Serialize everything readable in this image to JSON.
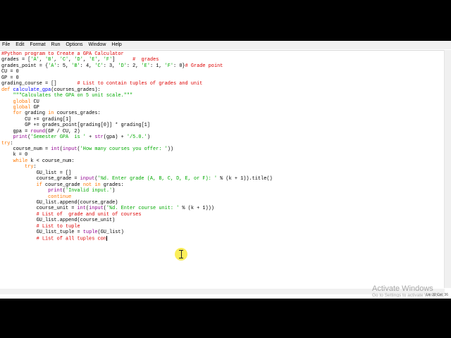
{
  "menu": [
    "File",
    "Edit",
    "Format",
    "Run",
    "Options",
    "Window",
    "Help"
  ],
  "code_lines": [
    [
      {
        "t": "#Python program to Create a GPA Calculator",
        "c": "cm"
      }
    ],
    [
      {
        "t": "grades = ["
      },
      {
        "t": "'A'",
        "c": "str"
      },
      {
        "t": ", "
      },
      {
        "t": "'B'",
        "c": "str"
      },
      {
        "t": ", "
      },
      {
        "t": "'C'",
        "c": "str"
      },
      {
        "t": ", "
      },
      {
        "t": "'D'",
        "c": "str"
      },
      {
        "t": ", "
      },
      {
        "t": "'E'",
        "c": "str"
      },
      {
        "t": ", "
      },
      {
        "t": "'F'",
        "c": "str"
      },
      {
        "t": "]      "
      },
      {
        "t": "#  grades",
        "c": "cm"
      }
    ],
    [
      {
        "t": "grades_point = {"
      },
      {
        "t": "'A'",
        "c": "str"
      },
      {
        "t": ": 5, "
      },
      {
        "t": "'B'",
        "c": "str"
      },
      {
        "t": ": 4, "
      },
      {
        "t": "'C'",
        "c": "str"
      },
      {
        "t": ": 3, "
      },
      {
        "t": "'D'",
        "c": "str"
      },
      {
        "t": ": 2, "
      },
      {
        "t": "'E'",
        "c": "str"
      },
      {
        "t": ": 1, "
      },
      {
        "t": "'F'",
        "c": "str"
      },
      {
        "t": ": 0}"
      },
      {
        "t": "# Grade point",
        "c": "cm"
      }
    ],
    [
      {
        "t": "CU = 0"
      }
    ],
    [
      {
        "t": "GP = 0"
      }
    ],
    [
      {
        "t": "grading_course = []       "
      },
      {
        "t": "# List to contain tuples of grades and unit",
        "c": "cm"
      }
    ],
    [
      {
        "t": "def ",
        "c": "kw"
      },
      {
        "t": "calculate_gpa",
        "c": "def"
      },
      {
        "t": "(courses_grades):"
      }
    ],
    [
      {
        "t": "    "
      },
      {
        "t": "\"\"\"Calculates the GPA on 5 unit scale.\"\"\"",
        "c": "str"
      }
    ],
    [
      {
        "t": "    "
      },
      {
        "t": "global",
        "c": "kw"
      },
      {
        "t": " CU"
      }
    ],
    [
      {
        "t": "    "
      },
      {
        "t": "global",
        "c": "kw"
      },
      {
        "t": " GP"
      }
    ],
    [
      {
        "t": "    "
      },
      {
        "t": "for",
        "c": "kw"
      },
      {
        "t": " grading "
      },
      {
        "t": "in",
        "c": "kw"
      },
      {
        "t": " courses_grades:"
      }
    ],
    [
      {
        "t": "        CU += grading[1]"
      }
    ],
    [
      {
        "t": "        GP += grades_point[grading[0]] * grading[1]"
      }
    ],
    [
      {
        "t": "    gpa = "
      },
      {
        "t": "round",
        "c": "bi"
      },
      {
        "t": "(GP / CU, 2)"
      }
    ],
    [
      {
        "t": "    "
      },
      {
        "t": "print",
        "c": "bi"
      },
      {
        "t": "("
      },
      {
        "t": "'Semester GPA  is '",
        "c": "str"
      },
      {
        "t": " + "
      },
      {
        "t": "str",
        "c": "bi"
      },
      {
        "t": "(gpa) + "
      },
      {
        "t": "'/5.0.'",
        "c": "str"
      },
      {
        "t": ")"
      }
    ],
    [
      {
        "t": "try",
        "c": "kw"
      },
      {
        "t": ":"
      }
    ],
    [
      {
        "t": "    course_num = "
      },
      {
        "t": "int",
        "c": "bi"
      },
      {
        "t": "("
      },
      {
        "t": "input",
        "c": "bi"
      },
      {
        "t": "("
      },
      {
        "t": "'How many courses you offer: '",
        "c": "str"
      },
      {
        "t": "))"
      }
    ],
    [
      {
        "t": "    k = 0"
      }
    ],
    [
      {
        "t": "    "
      },
      {
        "t": "while",
        "c": "kw"
      },
      {
        "t": " k < course_num:"
      }
    ],
    [
      {
        "t": "        "
      },
      {
        "t": "try",
        "c": "kw"
      },
      {
        "t": ":"
      }
    ],
    [
      {
        "t": "            GU_list = []"
      }
    ],
    [
      {
        "t": "            course_grade = "
      },
      {
        "t": "input",
        "c": "bi"
      },
      {
        "t": "("
      },
      {
        "t": "'%d. Enter grade (A, B, C, D, E, or F): '",
        "c": "str"
      },
      {
        "t": " % (k + 1)).title()"
      }
    ],
    [
      {
        "t": "            "
      },
      {
        "t": "if",
        "c": "kw"
      },
      {
        "t": " course_grade "
      },
      {
        "t": "not in",
        "c": "kw"
      },
      {
        "t": " grades:"
      }
    ],
    [
      {
        "t": "                "
      },
      {
        "t": "print",
        "c": "bi"
      },
      {
        "t": "("
      },
      {
        "t": "'Invalid input.'",
        "c": "str"
      },
      {
        "t": ")"
      }
    ],
    [
      {
        "t": "                "
      },
      {
        "t": "continue",
        "c": "kw"
      }
    ],
    [
      {
        "t": "            GU_list.append(course_grade)"
      }
    ],
    [
      {
        "t": "            course_unit = "
      },
      {
        "t": "int",
        "c": "bi"
      },
      {
        "t": "("
      },
      {
        "t": "input",
        "c": "bi"
      },
      {
        "t": "("
      },
      {
        "t": "'%d. Enter course unit: '",
        "c": "str"
      },
      {
        "t": " % (k + 1)))"
      }
    ],
    [
      {
        "t": "            "
      },
      {
        "t": "# List of  grade and unit of courses",
        "c": "cm"
      }
    ],
    [
      {
        "t": "            GU_list.append(course_unit)"
      }
    ],
    [
      {
        "t": "            "
      },
      {
        "t": "# List to tuple",
        "c": "cm"
      }
    ],
    [
      {
        "t": "            GU_list_tuple = "
      },
      {
        "t": "tuple",
        "c": "bi"
      },
      {
        "t": "(GU_list)"
      }
    ],
    [
      {
        "t": "            "
      },
      {
        "t": "# List of all tuples con",
        "c": "cm"
      }
    ]
  ],
  "status": {
    "position": "Ln: 32   Col: 36"
  },
  "watermark": {
    "title": "Activate Windows",
    "subtitle": "Go to Settings to activate Windows."
  }
}
